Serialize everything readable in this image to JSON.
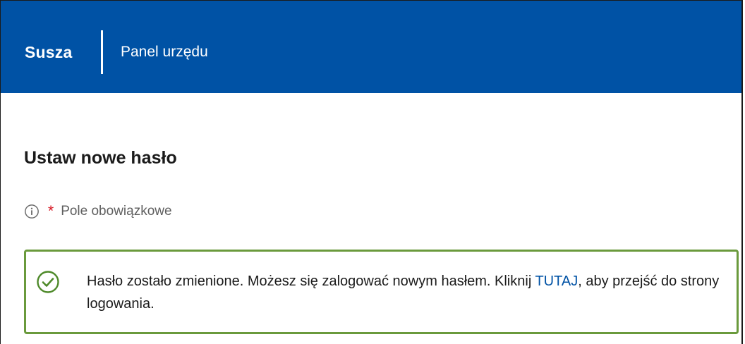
{
  "header": {
    "brand": "Susza",
    "panel_title": "Panel urzędu",
    "background": "#0052a5"
  },
  "page": {
    "title": "Ustaw nowe hasło"
  },
  "required_note": {
    "icon": "info-icon",
    "asterisk": "*",
    "text": "Pole obowiązkowe"
  },
  "alert": {
    "icon": "check-circle-icon",
    "border_color": "#6a9a3c",
    "text_before": "Hasło zostało zmienione. Możesz się zalogować nowym hasłem. Kliknij ",
    "link_text": "TUTAJ",
    "text_after": ", aby przejść do strony logowania."
  }
}
